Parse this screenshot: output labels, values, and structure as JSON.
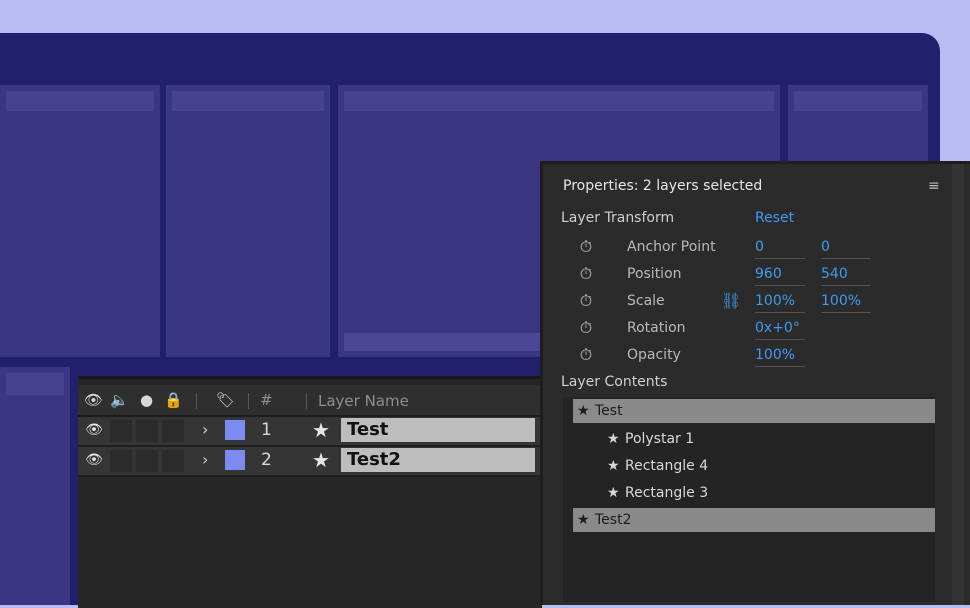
{
  "timeline": {
    "header": {
      "eye_icon": "eye-icon",
      "audio_icon": "speaker-icon",
      "solo_icon": "solo-dot-icon",
      "lock_icon": "lock-icon",
      "label_icon": "tag-icon",
      "number_col": "#",
      "layer_name_col": "Layer Name"
    },
    "layers": [
      {
        "number": "1",
        "name": "Test",
        "label_color": "#7b8bf0"
      },
      {
        "number": "2",
        "name": "Test2",
        "label_color": "#7b8bf0"
      }
    ]
  },
  "properties": {
    "title": "Properties: 2 layers selected",
    "transform_section": "Layer Transform",
    "reset": "Reset",
    "props": [
      {
        "label": "Anchor Point",
        "v1": "0",
        "v2": "0"
      },
      {
        "label": "Position",
        "v1": "960",
        "v2": "540"
      },
      {
        "label": "Scale",
        "v1": "100%",
        "v2": "100%"
      },
      {
        "label": "Rotation",
        "v1": "0x+0°",
        "v2": ""
      },
      {
        "label": "Opacity",
        "v1": "100%",
        "v2": ""
      }
    ],
    "contents_section": "Layer Contents",
    "contents": [
      {
        "name": "Test",
        "type": "layer"
      },
      {
        "name": "Polystar 1",
        "type": "shape"
      },
      {
        "name": "Rectangle 4",
        "type": "shape"
      },
      {
        "name": "Rectangle 3",
        "type": "shape"
      },
      {
        "name": "Test2",
        "type": "layer"
      }
    ]
  },
  "colors": {
    "accent": "#3d9cf0",
    "backdrop": "#b9bcf3",
    "app_bg": "#22206a",
    "panel": "#3a3682"
  }
}
